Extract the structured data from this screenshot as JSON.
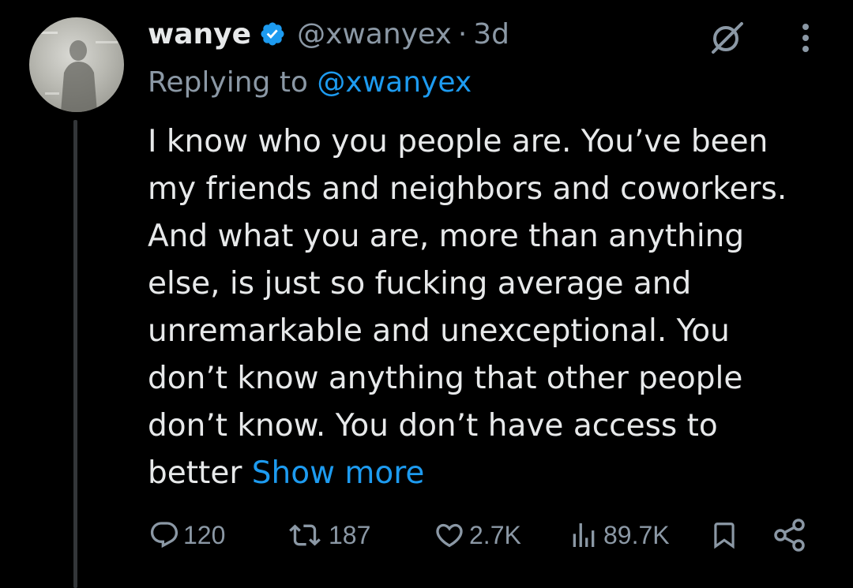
{
  "tweet": {
    "display_name": "wanye",
    "handle": "@xwanyex",
    "separator": "·",
    "time": "3d",
    "replying_prefix": "Replying to ",
    "replying_handle": "@xwanyex",
    "body_lines": [
      "I know who you people are. You’ve been",
      "my friends and neighbors and coworkers.",
      "And what you are, more than anything",
      "else, is just so fucking average and",
      "unremarkable and unexceptional. You",
      "don’t know anything that other people",
      "don’t know. You don’t have access to",
      "better "
    ],
    "show_more": "Show more"
  },
  "actions": {
    "replies": "120",
    "reposts": "187",
    "likes": "2.7K",
    "views": "89.7K"
  },
  "icons": [
    "verified-icon",
    "grok-icon",
    "more-icon",
    "reply-icon",
    "repost-icon",
    "like-icon",
    "views-icon",
    "bookmark-icon",
    "share-icon"
  ],
  "colors": {
    "background": "#000000",
    "text": "#e7e9ea",
    "secondary": "#8b98a5",
    "accent": "#1d9bf0"
  }
}
